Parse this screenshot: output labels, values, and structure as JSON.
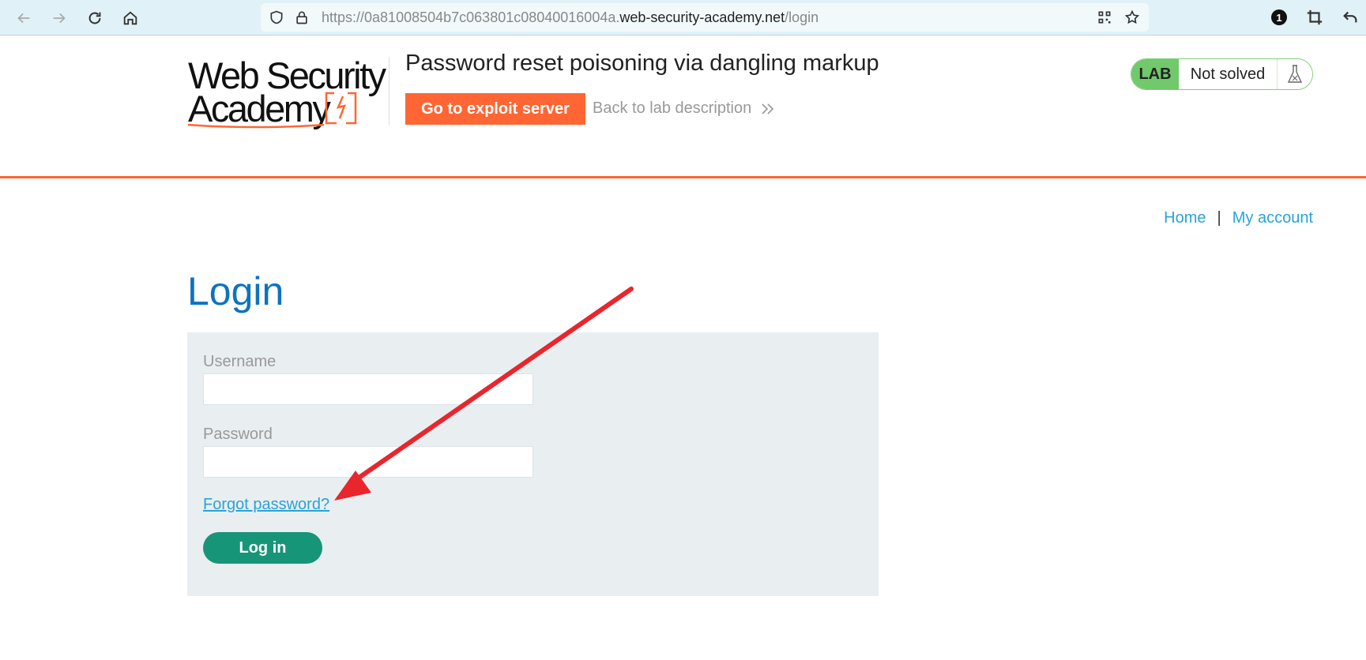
{
  "browser": {
    "url_prefix": "https://0a81008504b7c063801c08040016004a.",
    "url_domain": "web-security-academy.net",
    "url_path": "/login",
    "extension_badge": "1"
  },
  "header": {
    "logo_line1": "Web Security",
    "logo_line2": "Academy",
    "lab_title": "Password reset poisoning via dangling markup",
    "exploit_button": "Go to exploit server",
    "back_link": "Back to lab description",
    "lab_label": "LAB",
    "lab_status": "Not solved"
  },
  "nav": {
    "home": "Home",
    "separator": "|",
    "my_account": "My account"
  },
  "login": {
    "title": "Login",
    "username_label": "Username",
    "username_value": "",
    "password_label": "Password",
    "password_value": "",
    "forgot_link": "Forgot password?",
    "submit_button": "Log in"
  },
  "colors": {
    "accent_orange": "#ff6633",
    "link_blue": "#29a3d9",
    "title_blue": "#0d73bf",
    "button_green": "#179579",
    "lab_green": "#70c96a",
    "annotation_red": "#e8262c"
  }
}
